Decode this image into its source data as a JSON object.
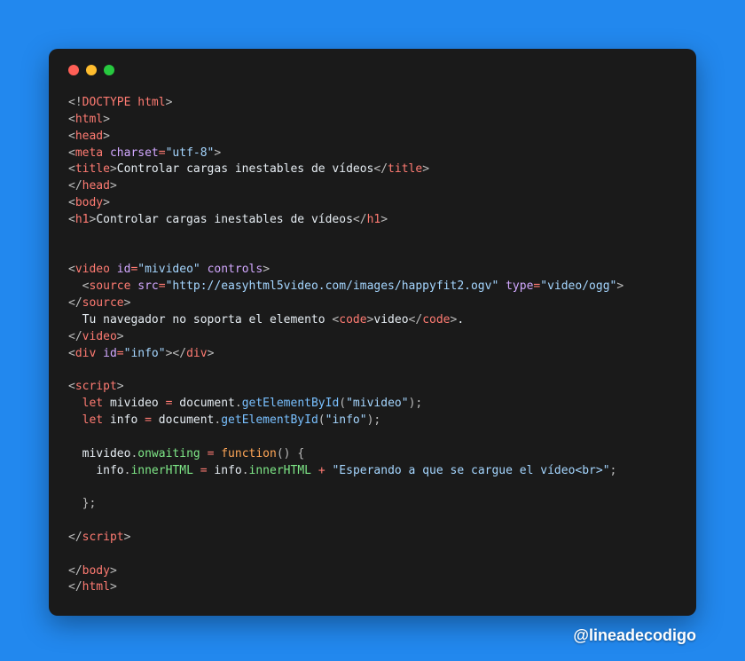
{
  "window": {
    "dots": [
      "red",
      "yellow",
      "green"
    ]
  },
  "code": {
    "lines": [
      [
        [
          "punc",
          "<!"
        ],
        [
          "tag",
          "DOCTYPE html"
        ],
        [
          "punc",
          ">"
        ]
      ],
      [
        [
          "punc",
          "<"
        ],
        [
          "tag",
          "html"
        ],
        [
          "punc",
          ">"
        ]
      ],
      [
        [
          "punc",
          "<"
        ],
        [
          "tag",
          "head"
        ],
        [
          "punc",
          ">"
        ]
      ],
      [
        [
          "punc",
          "<"
        ],
        [
          "tag",
          "meta"
        ],
        [
          "text",
          " "
        ],
        [
          "attr",
          "charset"
        ],
        [
          "eq",
          "="
        ],
        [
          "str",
          "\"utf-8\""
        ],
        [
          "punc",
          ">"
        ]
      ],
      [
        [
          "punc",
          "<"
        ],
        [
          "tag",
          "title"
        ],
        [
          "punc",
          ">"
        ],
        [
          "text",
          "Controlar cargas inestables de vídeos"
        ],
        [
          "punc",
          "</"
        ],
        [
          "tag",
          "title"
        ],
        [
          "punc",
          ">"
        ]
      ],
      [
        [
          "punc",
          "</"
        ],
        [
          "tag",
          "head"
        ],
        [
          "punc",
          ">"
        ]
      ],
      [
        [
          "punc",
          "<"
        ],
        [
          "tag",
          "body"
        ],
        [
          "punc",
          ">"
        ]
      ],
      [
        [
          "punc",
          "<"
        ],
        [
          "tag",
          "h1"
        ],
        [
          "punc",
          ">"
        ],
        [
          "text",
          "Controlar cargas inestables de vídeos"
        ],
        [
          "punc",
          "</"
        ],
        [
          "tag",
          "h1"
        ],
        [
          "punc",
          ">"
        ]
      ],
      [],
      [],
      [
        [
          "punc",
          "<"
        ],
        [
          "tag",
          "video"
        ],
        [
          "text",
          " "
        ],
        [
          "attr",
          "id"
        ],
        [
          "eq",
          "="
        ],
        [
          "str",
          "\"mivideo\""
        ],
        [
          "text",
          " "
        ],
        [
          "attr",
          "controls"
        ],
        [
          "punc",
          ">"
        ]
      ],
      [
        [
          "text",
          "  "
        ],
        [
          "punc",
          "<"
        ],
        [
          "tag",
          "source"
        ],
        [
          "text",
          " "
        ],
        [
          "attr",
          "src"
        ],
        [
          "eq",
          "="
        ],
        [
          "str",
          "\"http://easyhtml5video.com/images/happyfit2.ogv\""
        ],
        [
          "text",
          " "
        ],
        [
          "attr",
          "type"
        ],
        [
          "eq",
          "="
        ],
        [
          "str",
          "\"video/ogg\""
        ],
        [
          "punc",
          ">"
        ]
      ],
      [
        [
          "punc",
          "</"
        ],
        [
          "tag",
          "source"
        ],
        [
          "punc",
          ">"
        ]
      ],
      [
        [
          "text",
          "  Tu navegador no soporta el elemento "
        ],
        [
          "punc",
          "<"
        ],
        [
          "tag",
          "code"
        ],
        [
          "punc",
          ">"
        ],
        [
          "text",
          "video"
        ],
        [
          "punc",
          "</"
        ],
        [
          "tag",
          "code"
        ],
        [
          "punc",
          ">"
        ],
        [
          "text",
          "."
        ]
      ],
      [
        [
          "punc",
          "</"
        ],
        [
          "tag",
          "video"
        ],
        [
          "punc",
          ">"
        ]
      ],
      [
        [
          "punc",
          "<"
        ],
        [
          "tag",
          "div"
        ],
        [
          "text",
          " "
        ],
        [
          "attr",
          "id"
        ],
        [
          "eq",
          "="
        ],
        [
          "str",
          "\"info\""
        ],
        [
          "punc",
          ">"
        ],
        [
          "punc",
          "</"
        ],
        [
          "tag",
          "div"
        ],
        [
          "punc",
          ">"
        ]
      ],
      [],
      [
        [
          "punc",
          "<"
        ],
        [
          "tag",
          "script"
        ],
        [
          "punc",
          ">"
        ]
      ],
      [
        [
          "text",
          "  "
        ],
        [
          "kw",
          "let"
        ],
        [
          "text",
          " "
        ],
        [
          "var",
          "mivideo"
        ],
        [
          "text",
          " "
        ],
        [
          "eq",
          "="
        ],
        [
          "text",
          " "
        ],
        [
          "var",
          "document"
        ],
        [
          "punc",
          "."
        ],
        [
          "func",
          "getElementById"
        ],
        [
          "punc",
          "("
        ],
        [
          "str",
          "\"mivideo\""
        ],
        [
          "punc",
          ")"
        ],
        [
          "punc",
          ";"
        ]
      ],
      [
        [
          "text",
          "  "
        ],
        [
          "kw",
          "let"
        ],
        [
          "text",
          " "
        ],
        [
          "var",
          "info"
        ],
        [
          "text",
          " "
        ],
        [
          "eq",
          "="
        ],
        [
          "text",
          " "
        ],
        [
          "var",
          "document"
        ],
        [
          "punc",
          "."
        ],
        [
          "func",
          "getElementById"
        ],
        [
          "punc",
          "("
        ],
        [
          "str",
          "\"info\""
        ],
        [
          "punc",
          ")"
        ],
        [
          "punc",
          ";"
        ]
      ],
      [],
      [
        [
          "text",
          "  "
        ],
        [
          "var",
          "mivideo"
        ],
        [
          "punc",
          "."
        ],
        [
          "prop",
          "onwaiting"
        ],
        [
          "text",
          " "
        ],
        [
          "eq",
          "="
        ],
        [
          "text",
          " "
        ],
        [
          "funcY",
          "function"
        ],
        [
          "punc",
          "("
        ],
        [
          "punc",
          ")"
        ],
        [
          "text",
          " "
        ],
        [
          "punc",
          "{"
        ]
      ],
      [
        [
          "text",
          "    "
        ],
        [
          "var",
          "info"
        ],
        [
          "punc",
          "."
        ],
        [
          "prop",
          "innerHTML"
        ],
        [
          "text",
          " "
        ],
        [
          "eq",
          "="
        ],
        [
          "text",
          " "
        ],
        [
          "var",
          "info"
        ],
        [
          "punc",
          "."
        ],
        [
          "prop",
          "innerHTML"
        ],
        [
          "text",
          " "
        ],
        [
          "eq",
          "+"
        ],
        [
          "text",
          " "
        ],
        [
          "str",
          "\"Esperando a que se cargue el vídeo<br>\""
        ],
        [
          "punc",
          ";"
        ]
      ],
      [],
      [
        [
          "text",
          "  "
        ],
        [
          "punc",
          "}"
        ],
        [
          "punc",
          ";"
        ]
      ],
      [],
      [
        [
          "punc",
          "</"
        ],
        [
          "tag",
          "script"
        ],
        [
          "punc",
          ">"
        ]
      ],
      [],
      [
        [
          "punc",
          "</"
        ],
        [
          "tag",
          "body"
        ],
        [
          "punc",
          ">"
        ]
      ],
      [
        [
          "punc",
          "</"
        ],
        [
          "tag",
          "html"
        ],
        [
          "punc",
          ">"
        ]
      ]
    ]
  },
  "watermark": "@lineadecodigo"
}
